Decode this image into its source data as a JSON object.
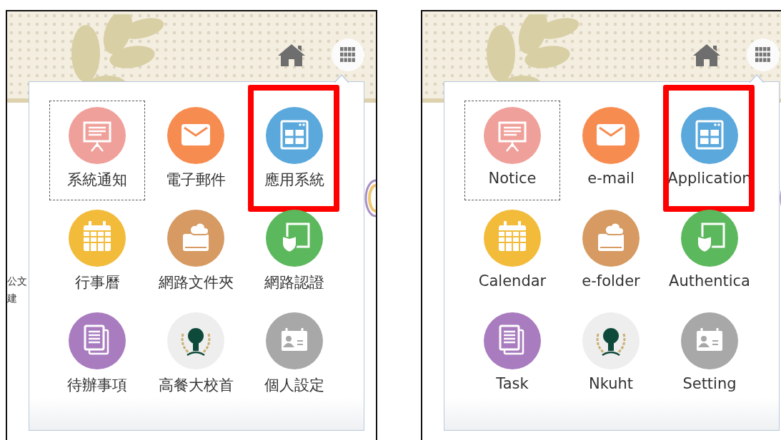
{
  "panels": [
    {
      "side_texts": [
        "公文",
        "建"
      ],
      "items": [
        {
          "label": "系統通知",
          "kind": "notice",
          "color": "#f0a09a",
          "focused": true,
          "highlighted": false
        },
        {
          "label": "電子郵件",
          "kind": "mail",
          "color": "#f78c50",
          "focused": false,
          "highlighted": false
        },
        {
          "label": "應用系統",
          "kind": "app",
          "color": "#5aa8dc",
          "focused": false,
          "highlighted": true
        },
        {
          "label": "行事曆",
          "kind": "calendar",
          "color": "#f2bb3a",
          "focused": false,
          "highlighted": false
        },
        {
          "label": "網路文件夾",
          "kind": "folder",
          "color": "#d69a62",
          "focused": false,
          "highlighted": false
        },
        {
          "label": "網路認證",
          "kind": "auth",
          "color": "#5cb85c",
          "focused": false,
          "highlighted": false
        },
        {
          "label": "待辦事項",
          "kind": "task",
          "color": "#a87cbf",
          "focused": false,
          "highlighted": false
        },
        {
          "label": "高餐大校首",
          "kind": "logo",
          "color": "#eeeeee",
          "focused": false,
          "highlighted": false
        },
        {
          "label": "個人設定",
          "kind": "setting",
          "color": "#a8a8a8",
          "focused": false,
          "highlighted": false
        }
      ]
    },
    {
      "items": [
        {
          "label": "Notice",
          "kind": "notice",
          "color": "#f0a09a",
          "focused": true,
          "highlighted": false
        },
        {
          "label": "e-mail",
          "kind": "mail",
          "color": "#f78c50",
          "focused": false,
          "highlighted": false
        },
        {
          "label": "Application",
          "kind": "app",
          "color": "#5aa8dc",
          "focused": false,
          "highlighted": true
        },
        {
          "label": "Calendar",
          "kind": "calendar",
          "color": "#f2bb3a",
          "focused": false,
          "highlighted": false
        },
        {
          "label": "e-folder",
          "kind": "folder",
          "color": "#d69a62",
          "focused": false,
          "highlighted": false
        },
        {
          "label": "Authentica",
          "kind": "auth",
          "color": "#5cb85c",
          "focused": false,
          "highlighted": false
        },
        {
          "label": "Task",
          "kind": "task",
          "color": "#a87cbf",
          "focused": false,
          "highlighted": false
        },
        {
          "label": "Nkuht",
          "kind": "logo",
          "color": "#eeeeee",
          "focused": false,
          "highlighted": false
        },
        {
          "label": "Setting",
          "kind": "setting",
          "color": "#a8a8a8",
          "focused": false,
          "highlighted": false
        }
      ]
    }
  ]
}
